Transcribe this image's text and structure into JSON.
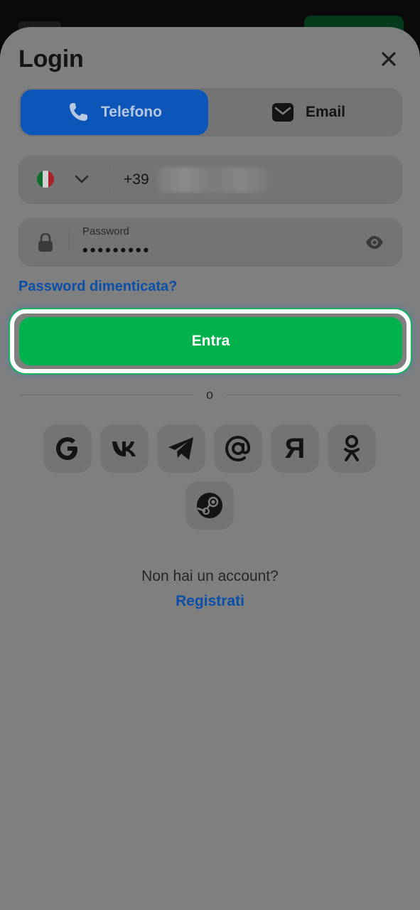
{
  "login": {
    "title": "Login",
    "tabs": [
      {
        "label": "Telefono",
        "icon": "phone-icon",
        "active": true
      },
      {
        "label": "Email",
        "icon": "mail-icon",
        "active": false
      }
    ],
    "phone": {
      "country_flag": "flag-italy-icon",
      "prefix": "+39"
    },
    "password": {
      "label": "Password",
      "value": "•••••••••"
    },
    "forgot_label": "Password dimenticata?",
    "submit_label": "Entra",
    "or_label": "o",
    "social": [
      "google-icon",
      "vk-icon",
      "telegram-icon",
      "mail-at-icon",
      "yandex-icon",
      "odnoklassniki-icon",
      "steam-icon"
    ],
    "no_account_label": "Non hai un account?",
    "register_label": "Registrati"
  },
  "colors": {
    "overlay": "#7f7f7f",
    "accent_green": "#00b14c",
    "active_tab": "#0b56b8",
    "link_blue": "#0a4fa8"
  }
}
